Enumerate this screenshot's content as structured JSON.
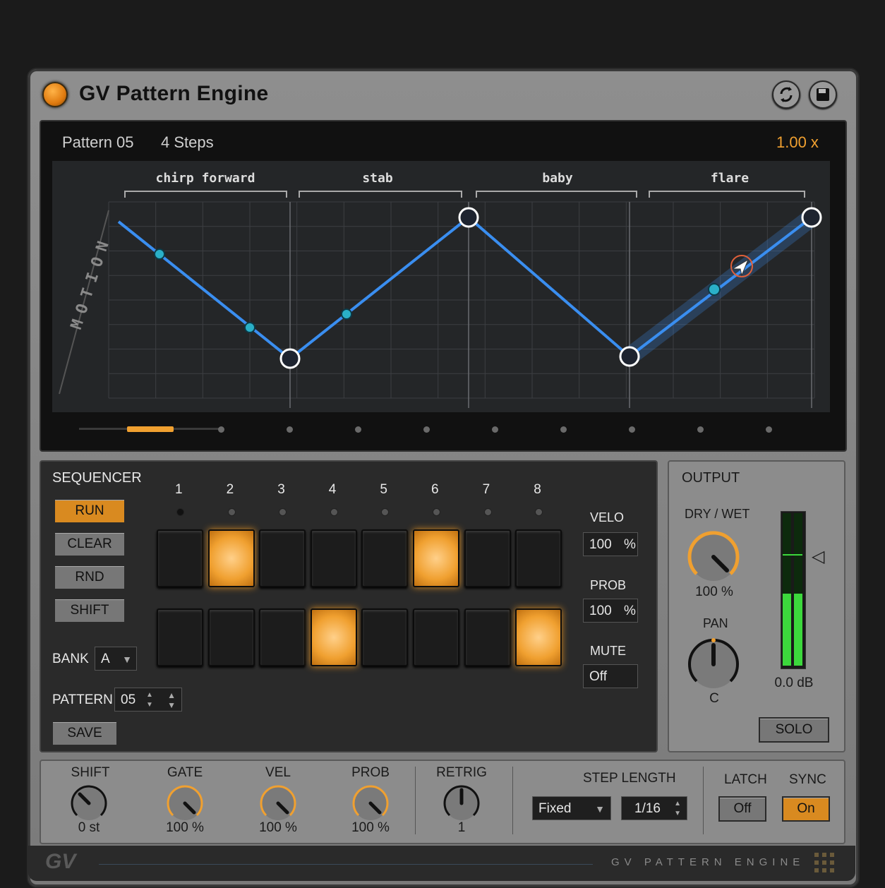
{
  "window": {
    "title": "GV Pattern Engine"
  },
  "display": {
    "pattern": "Pattern 05",
    "steps": "4 Steps",
    "rate": "1.00 x",
    "axis_label": "MOTION",
    "segments": [
      "chirp forward",
      "stab",
      "baby",
      "flare"
    ]
  },
  "sequencer": {
    "title": "SEQUENCER",
    "buttons": {
      "run": "RUN",
      "clear": "CLEAR",
      "rnd": "RND",
      "shift": "SHIFT",
      "save": "SAVE"
    },
    "step_numbers": [
      "1",
      "2",
      "3",
      "4",
      "5",
      "6",
      "7",
      "8"
    ],
    "row1": [
      false,
      true,
      false,
      false,
      false,
      true,
      false,
      false
    ],
    "row2": [
      false,
      false,
      false,
      true,
      false,
      false,
      false,
      true
    ],
    "bank_label": "BANK",
    "bank_value": "A",
    "pattern_label": "PATTERN",
    "pattern_value": "05",
    "velo_label": "VELO",
    "velo_value": "100",
    "prob_label": "PROB",
    "prob_value": "100",
    "percent": "%",
    "mute_label": "MUTE",
    "mute_value": "Off"
  },
  "output": {
    "title": "OUTPUT",
    "drywet_label": "DRY / WET",
    "drywet_value": "100 %",
    "pan_label": "PAN",
    "pan_value": "C",
    "level": "0.0 dB",
    "solo": "SOLO"
  },
  "controls": {
    "shift": {
      "label": "SHIFT",
      "value": "0 st"
    },
    "gate": {
      "label": "GATE",
      "value": "100 %"
    },
    "vel": {
      "label": "VEL",
      "value": "100 %"
    },
    "prob": {
      "label": "PROB",
      "value": "100 %"
    },
    "retrig": {
      "label": "RETRIG",
      "value": "1"
    },
    "step_length_label": "STEP LENGTH",
    "step_mode": "Fixed",
    "step_value": "1/16",
    "latch_label": "LATCH",
    "latch_value": "Off",
    "sync_label": "SYNC",
    "sync_value": "On"
  },
  "footer": {
    "logo": "GV",
    "brand": "GV PATTERN ENGINE"
  },
  "colors": {
    "accent": "#f0a030",
    "line": "#3a8ef0",
    "meter": "#3cd83c"
  }
}
